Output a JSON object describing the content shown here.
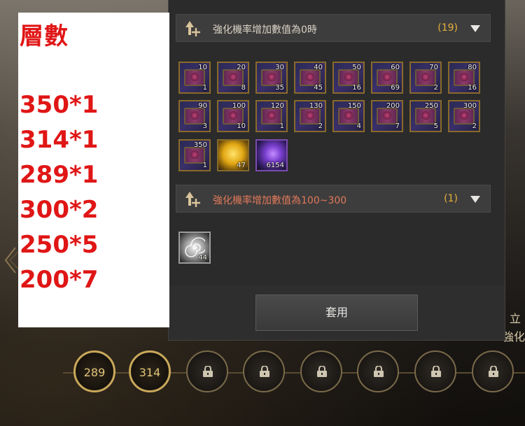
{
  "note": {
    "title": "層數",
    "lines": [
      "350*1",
      "314*1",
      "289*1",
      "300*2",
      "250*5",
      "200*7"
    ]
  },
  "panel": {
    "section1": {
      "label": "強化機率增加數值為0時",
      "count": "(19)"
    },
    "section2": {
      "label": "強化機率增加數值為100~300",
      "count": "(1)"
    },
    "items1": [
      {
        "level": "10",
        "qty": "1"
      },
      {
        "level": "20",
        "qty": "8"
      },
      {
        "level": "30",
        "qty": "35"
      },
      {
        "level": "40",
        "qty": "45"
      },
      {
        "level": "50",
        "qty": "16"
      },
      {
        "level": "60",
        "qty": "69"
      },
      {
        "level": "70",
        "qty": "2"
      },
      {
        "level": "80",
        "qty": "16"
      },
      {
        "level": "90",
        "qty": "3"
      },
      {
        "level": "100",
        "qty": "10"
      },
      {
        "level": "120",
        "qty": "1"
      },
      {
        "level": "130",
        "qty": "2"
      },
      {
        "level": "150",
        "qty": "4"
      },
      {
        "level": "200",
        "qty": "7"
      },
      {
        "level": "250",
        "qty": "5"
      },
      {
        "level": "300",
        "qty": "2"
      },
      {
        "level": "350",
        "qty": "1"
      },
      {
        "level": "",
        "qty": "47"
      },
      {
        "level": "",
        "qty": "6154"
      }
    ],
    "items2": [
      {
        "level": "",
        "qty": "44"
      }
    ],
    "apply_label": "套用"
  },
  "side": {
    "line1": "立",
    "line2": "強化"
  },
  "slots": {
    "filled": [
      "289",
      "314"
    ]
  },
  "colors": {
    "accent": "#e5b13a",
    "note_text": "#e01616",
    "warn_text": "#e0795a"
  }
}
